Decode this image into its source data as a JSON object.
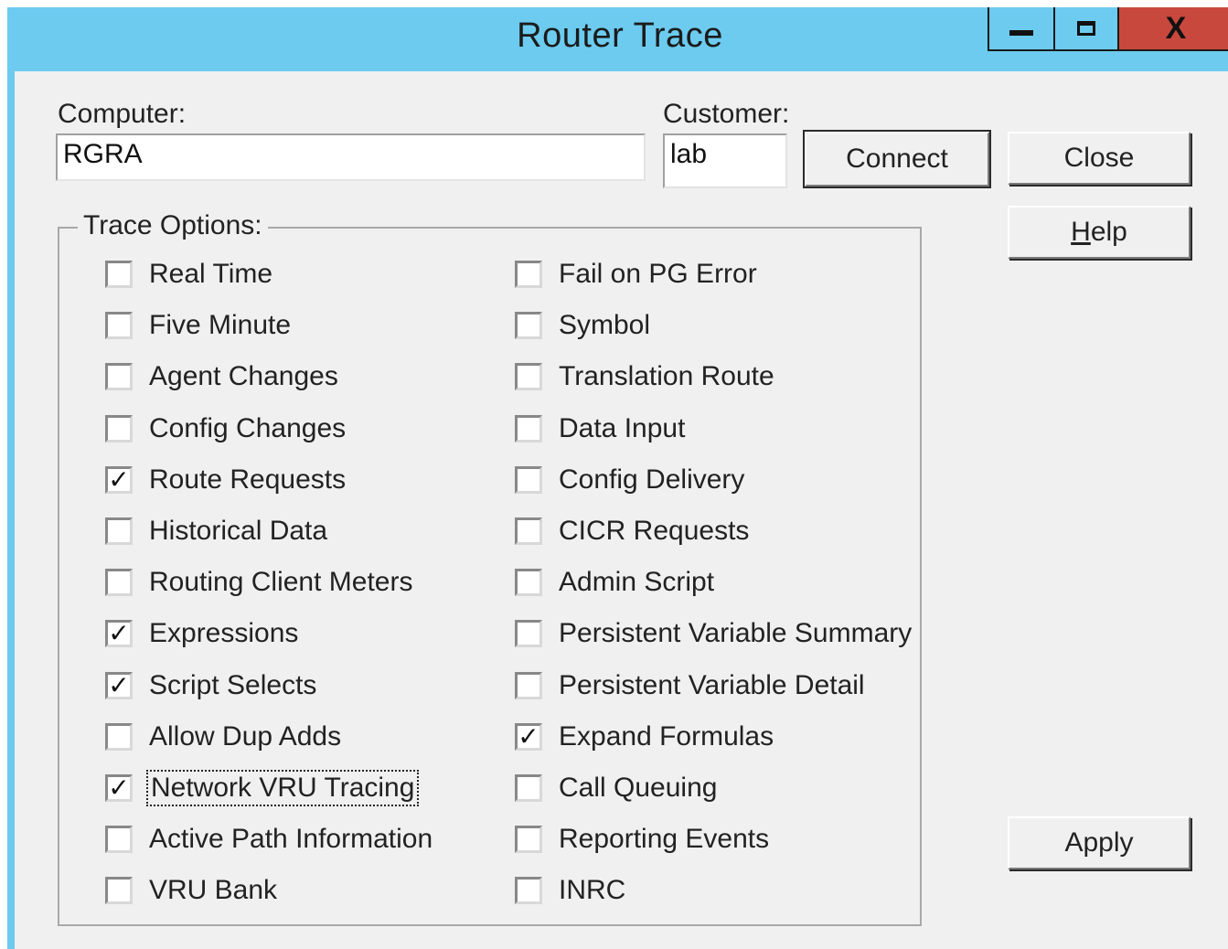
{
  "window": {
    "title": "Router Trace",
    "controls": {
      "minimize": "minimize",
      "maximize": "maximize",
      "close": "X"
    }
  },
  "computer": {
    "label": "Computer:",
    "value": "RGRA"
  },
  "customer": {
    "label": "Customer:",
    "value": "lab"
  },
  "buttons": {
    "connect": "Connect",
    "close": "Close",
    "help_prefix": "H",
    "help_rest": "elp",
    "apply": "Apply"
  },
  "trace_options": {
    "label": "Trace Options:",
    "left": [
      {
        "label": "Real Time",
        "checked": false
      },
      {
        "label": "Five Minute",
        "checked": false
      },
      {
        "label": "Agent Changes",
        "checked": false
      },
      {
        "label": "Config Changes",
        "checked": false
      },
      {
        "label": "Route Requests",
        "checked": true
      },
      {
        "label": "Historical Data",
        "checked": false
      },
      {
        "label": "Routing Client Meters",
        "checked": false
      },
      {
        "label": "Expressions",
        "checked": true
      },
      {
        "label": "Script Selects",
        "checked": true
      },
      {
        "label": "Allow Dup Adds",
        "checked": false
      },
      {
        "label": "Network VRU Tracing",
        "checked": true,
        "focused": true
      },
      {
        "label": "Active Path Information",
        "checked": false
      },
      {
        "label": "VRU Bank",
        "checked": false
      }
    ],
    "right": [
      {
        "label": "Fail on PG Error",
        "checked": false
      },
      {
        "label": "Symbol",
        "checked": false
      },
      {
        "label": "Translation Route",
        "checked": false
      },
      {
        "label": "Data Input",
        "checked": false
      },
      {
        "label": "Config Delivery",
        "checked": false
      },
      {
        "label": "CICR Requests",
        "checked": false
      },
      {
        "label": "Admin Script",
        "checked": false
      },
      {
        "label": "Persistent Variable Summary",
        "checked": false
      },
      {
        "label": "Persistent Variable Detail",
        "checked": false
      },
      {
        "label": "Expand Formulas",
        "checked": true
      },
      {
        "label": "Call Queuing",
        "checked": false
      },
      {
        "label": "Reporting Events",
        "checked": false
      },
      {
        "label": "INRC",
        "checked": false
      }
    ],
    "check_glyph": "✓"
  }
}
